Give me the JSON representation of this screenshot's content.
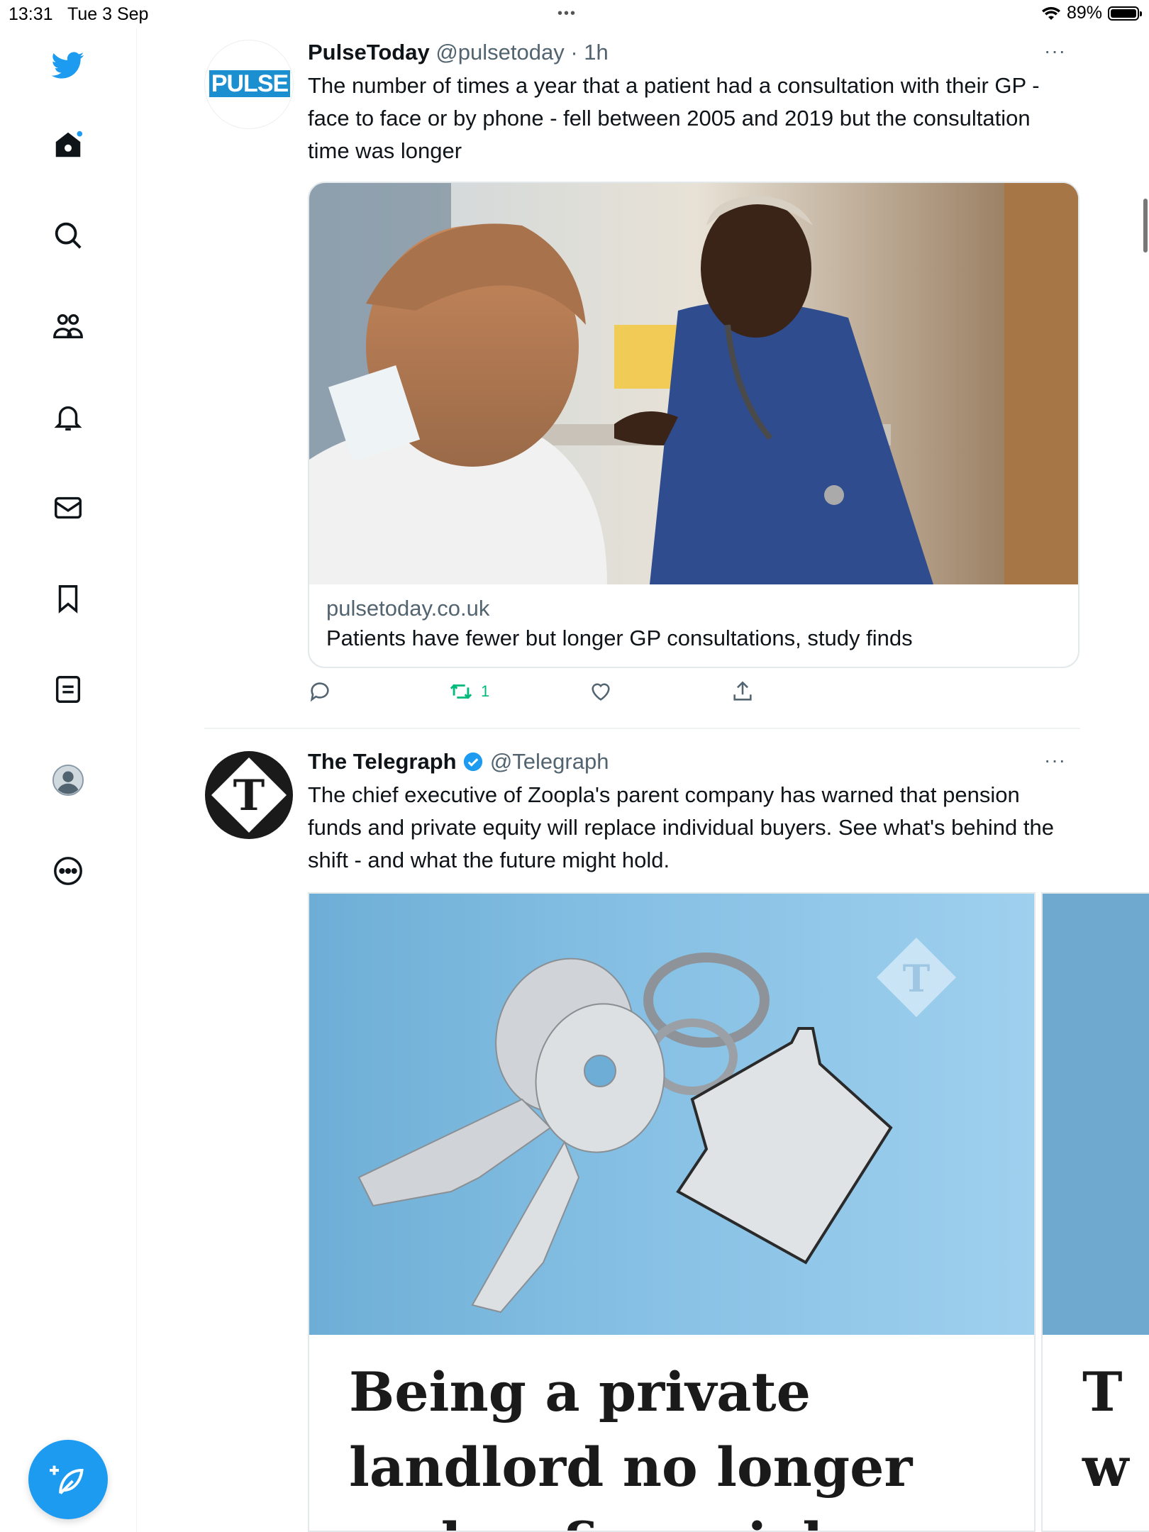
{
  "status": {
    "time": "13:31",
    "date": "Tue 3 Sep",
    "battery": "89%"
  },
  "sidebar": {
    "items": [
      {
        "name": "home"
      },
      {
        "name": "explore"
      },
      {
        "name": "communities"
      },
      {
        "name": "notifications"
      },
      {
        "name": "messages"
      },
      {
        "name": "bookmarks"
      },
      {
        "name": "lists"
      },
      {
        "name": "profile"
      },
      {
        "name": "more"
      }
    ]
  },
  "tweets": [
    {
      "name": "PulseToday",
      "handle": "@pulsetoday",
      "time": "· 1h",
      "more": "···",
      "avatar_text": "PULSE",
      "text": "The number of times a year that a patient had a consultation with their GP - face to face or by phone - fell between 2005 and 2019 but the consultation time was longer",
      "card": {
        "domain": "pulsetoday.co.uk",
        "title": "Patients have fewer but longer GP consultations, study finds"
      },
      "retweets": "1"
    },
    {
      "name": "The Telegraph",
      "handle": "@Telegraph",
      "more": "···",
      "text": "The chief executive of Zoopla's parent company has warned that pension funds and private equity will replace individual buyers. See what's behind the shift - and what the future might hold.",
      "headline": "Being a private landlord no longer makes financial sense",
      "next_headline": "T w"
    }
  ],
  "colors": {
    "accent": "#1d9bf0",
    "retweet": "#00ba7c",
    "muted": "#536471"
  }
}
